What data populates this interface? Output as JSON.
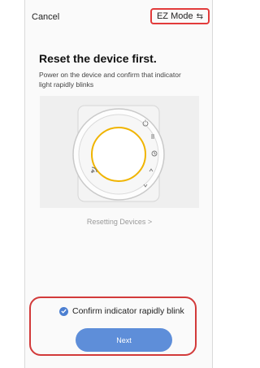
{
  "header": {
    "cancel_label": "Cancel",
    "mode_label": "EZ Mode",
    "mode_icon": "swap-arrows-icon"
  },
  "main": {
    "title": "Reset the device first.",
    "description": "Power on the device and confirm that indicator light rapidly blinks",
    "resetting_link": "Resetting Devices"
  },
  "footer": {
    "confirm_label": "Confirm indicator rapidly blink",
    "confirm_checked": true,
    "next_label": "Next"
  },
  "colors": {
    "accent": "#5e8ed9",
    "checkbox": "#4c7fd1",
    "highlight": "#e23b3b",
    "indicator_ring": "#f0b400"
  }
}
